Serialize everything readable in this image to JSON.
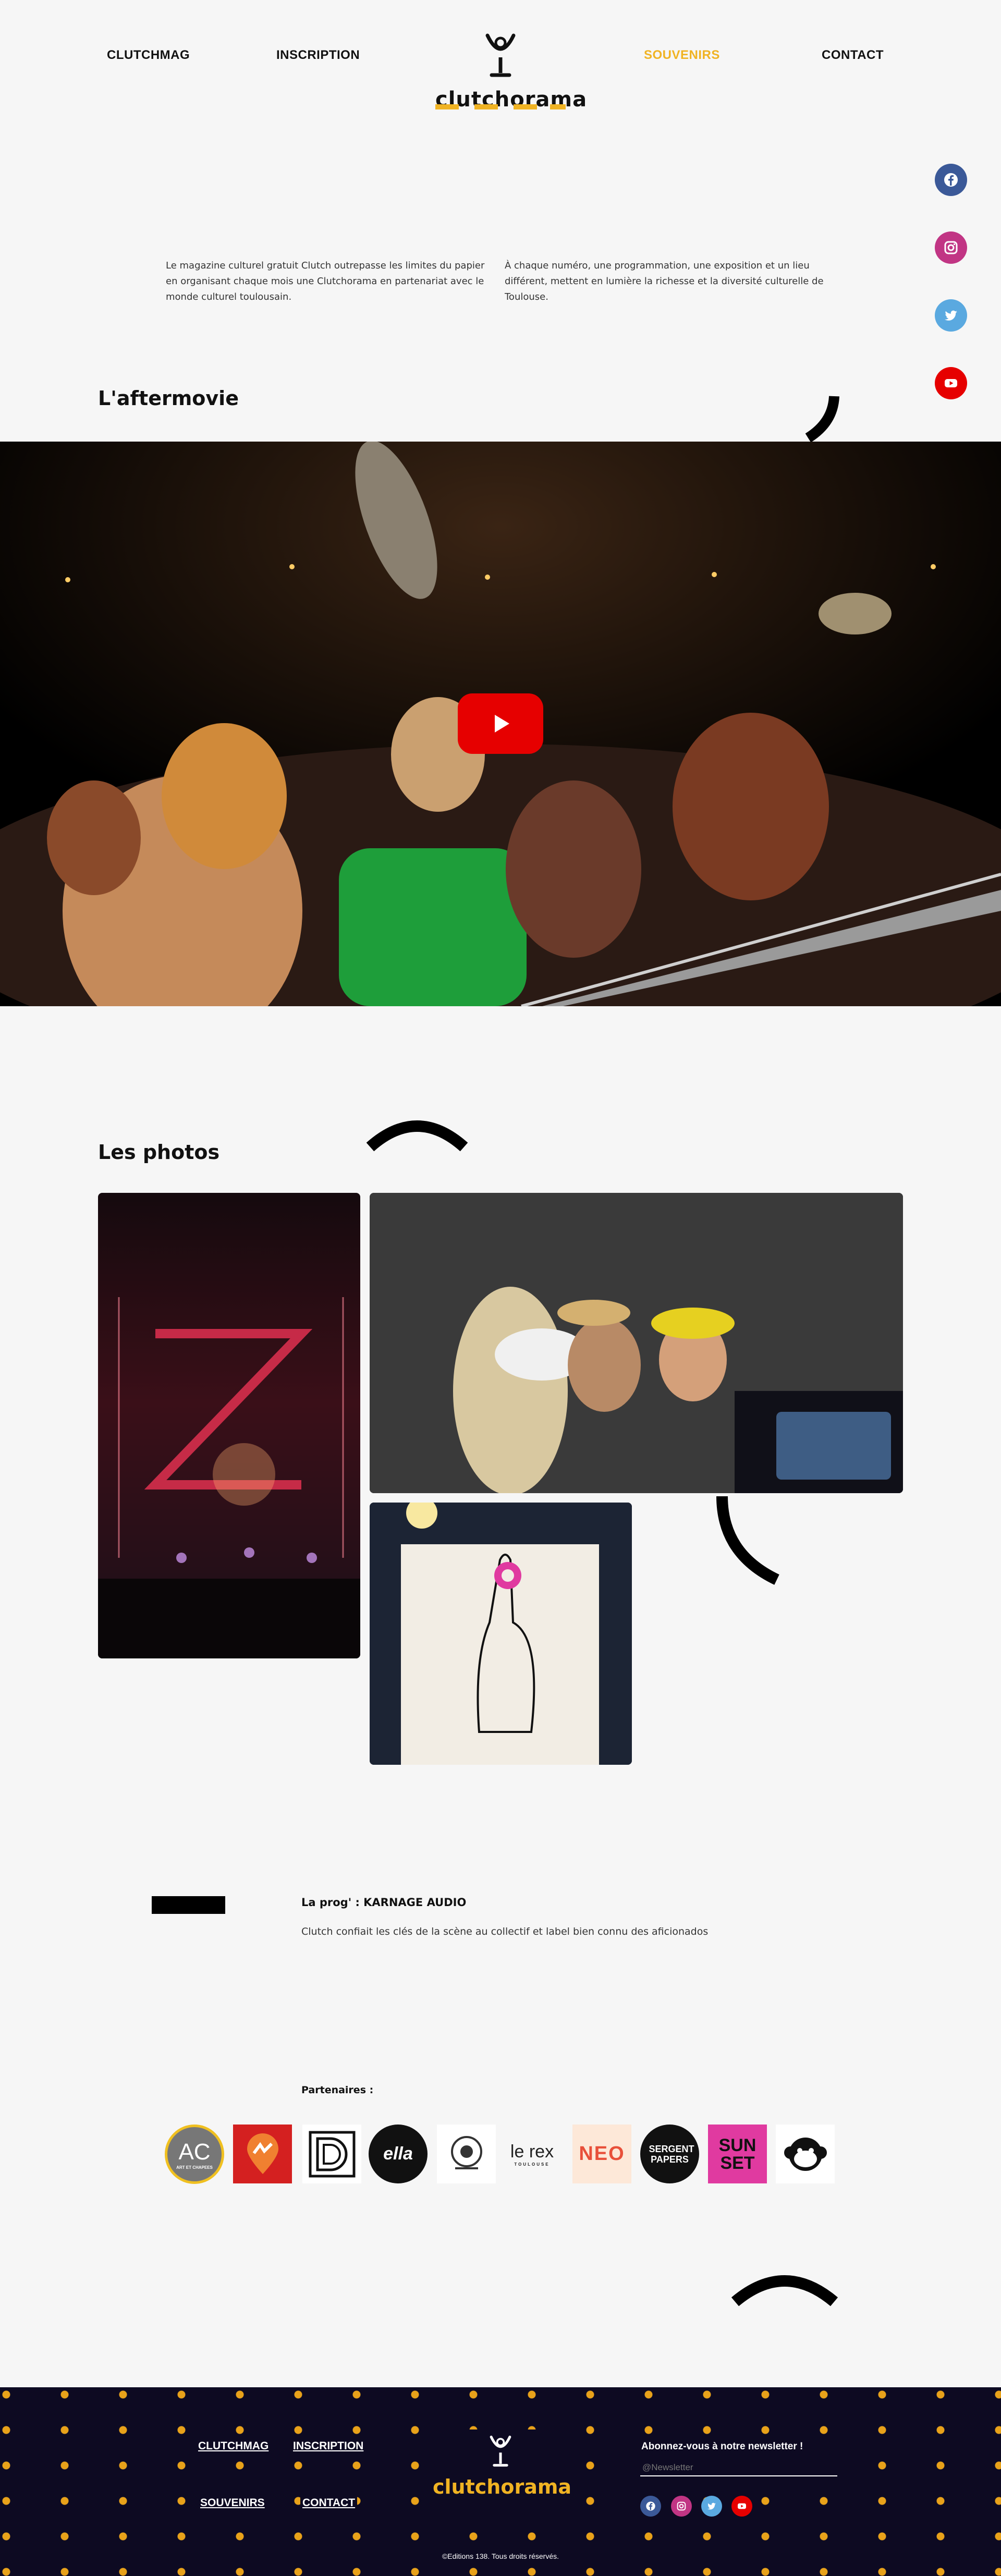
{
  "header": {
    "nav": [
      "CLUTCHMAG",
      "INSCRIPTION",
      "SOUVENIRS",
      "CONTACT"
    ],
    "logo_text": "clutchorama"
  },
  "colors": {
    "accent": "#f0b323",
    "background": "#f6f6f6",
    "footer_bg": "#0d0a22",
    "youtube_red": "#e60000"
  },
  "social": [
    "facebook-icon",
    "instagram-icon",
    "twitter-icon",
    "youtube-icon"
  ],
  "intro": {
    "left": "Le magazine culturel gratuit Clutch outrepasse les limites du papier en organisant chaque mois une Clutchorama en partenariat avec le monde culturel toulousain.",
    "right": "À chaque numéro, une programmation, une exposition et un lieu différent, mettent en lumière la richesse et la diversité culturelle de Toulouse."
  },
  "aftermovie": {
    "title": "L'aftermovie"
  },
  "photos": {
    "title": "Les photos"
  },
  "prog": {
    "label": "La prog' : KARNAGE AUDIO",
    "description": "Clutch confiait les clés de la scène au collectif et label bien connu des aficionados"
  },
  "partners": {
    "label": "Partenaires :",
    "logos": [
      {
        "name": "AC",
        "caption": "ART ET CHAPEES"
      },
      {
        "name": ""
      },
      {
        "name": ""
      },
      {
        "name": "ella"
      },
      {
        "name": ""
      },
      {
        "name": "le rex",
        "caption": "TOULOUSE"
      },
      {
        "name": "NEO"
      },
      {
        "name": "SERGENT PAPERS"
      },
      {
        "name": "SUN SET"
      },
      {
        "name": ""
      }
    ]
  },
  "footer": {
    "links": [
      "CLUTCHMAG",
      "INSCRIPTION",
      "SOUVENIRS",
      "CONTACT"
    ],
    "logo_text": "clutchorama",
    "newsletter_title": "Abonnez-vous à notre newsletter !",
    "newsletter_placeholder": "@Newsletter",
    "copyright": "©Editions 138. Tous droits réservés."
  }
}
